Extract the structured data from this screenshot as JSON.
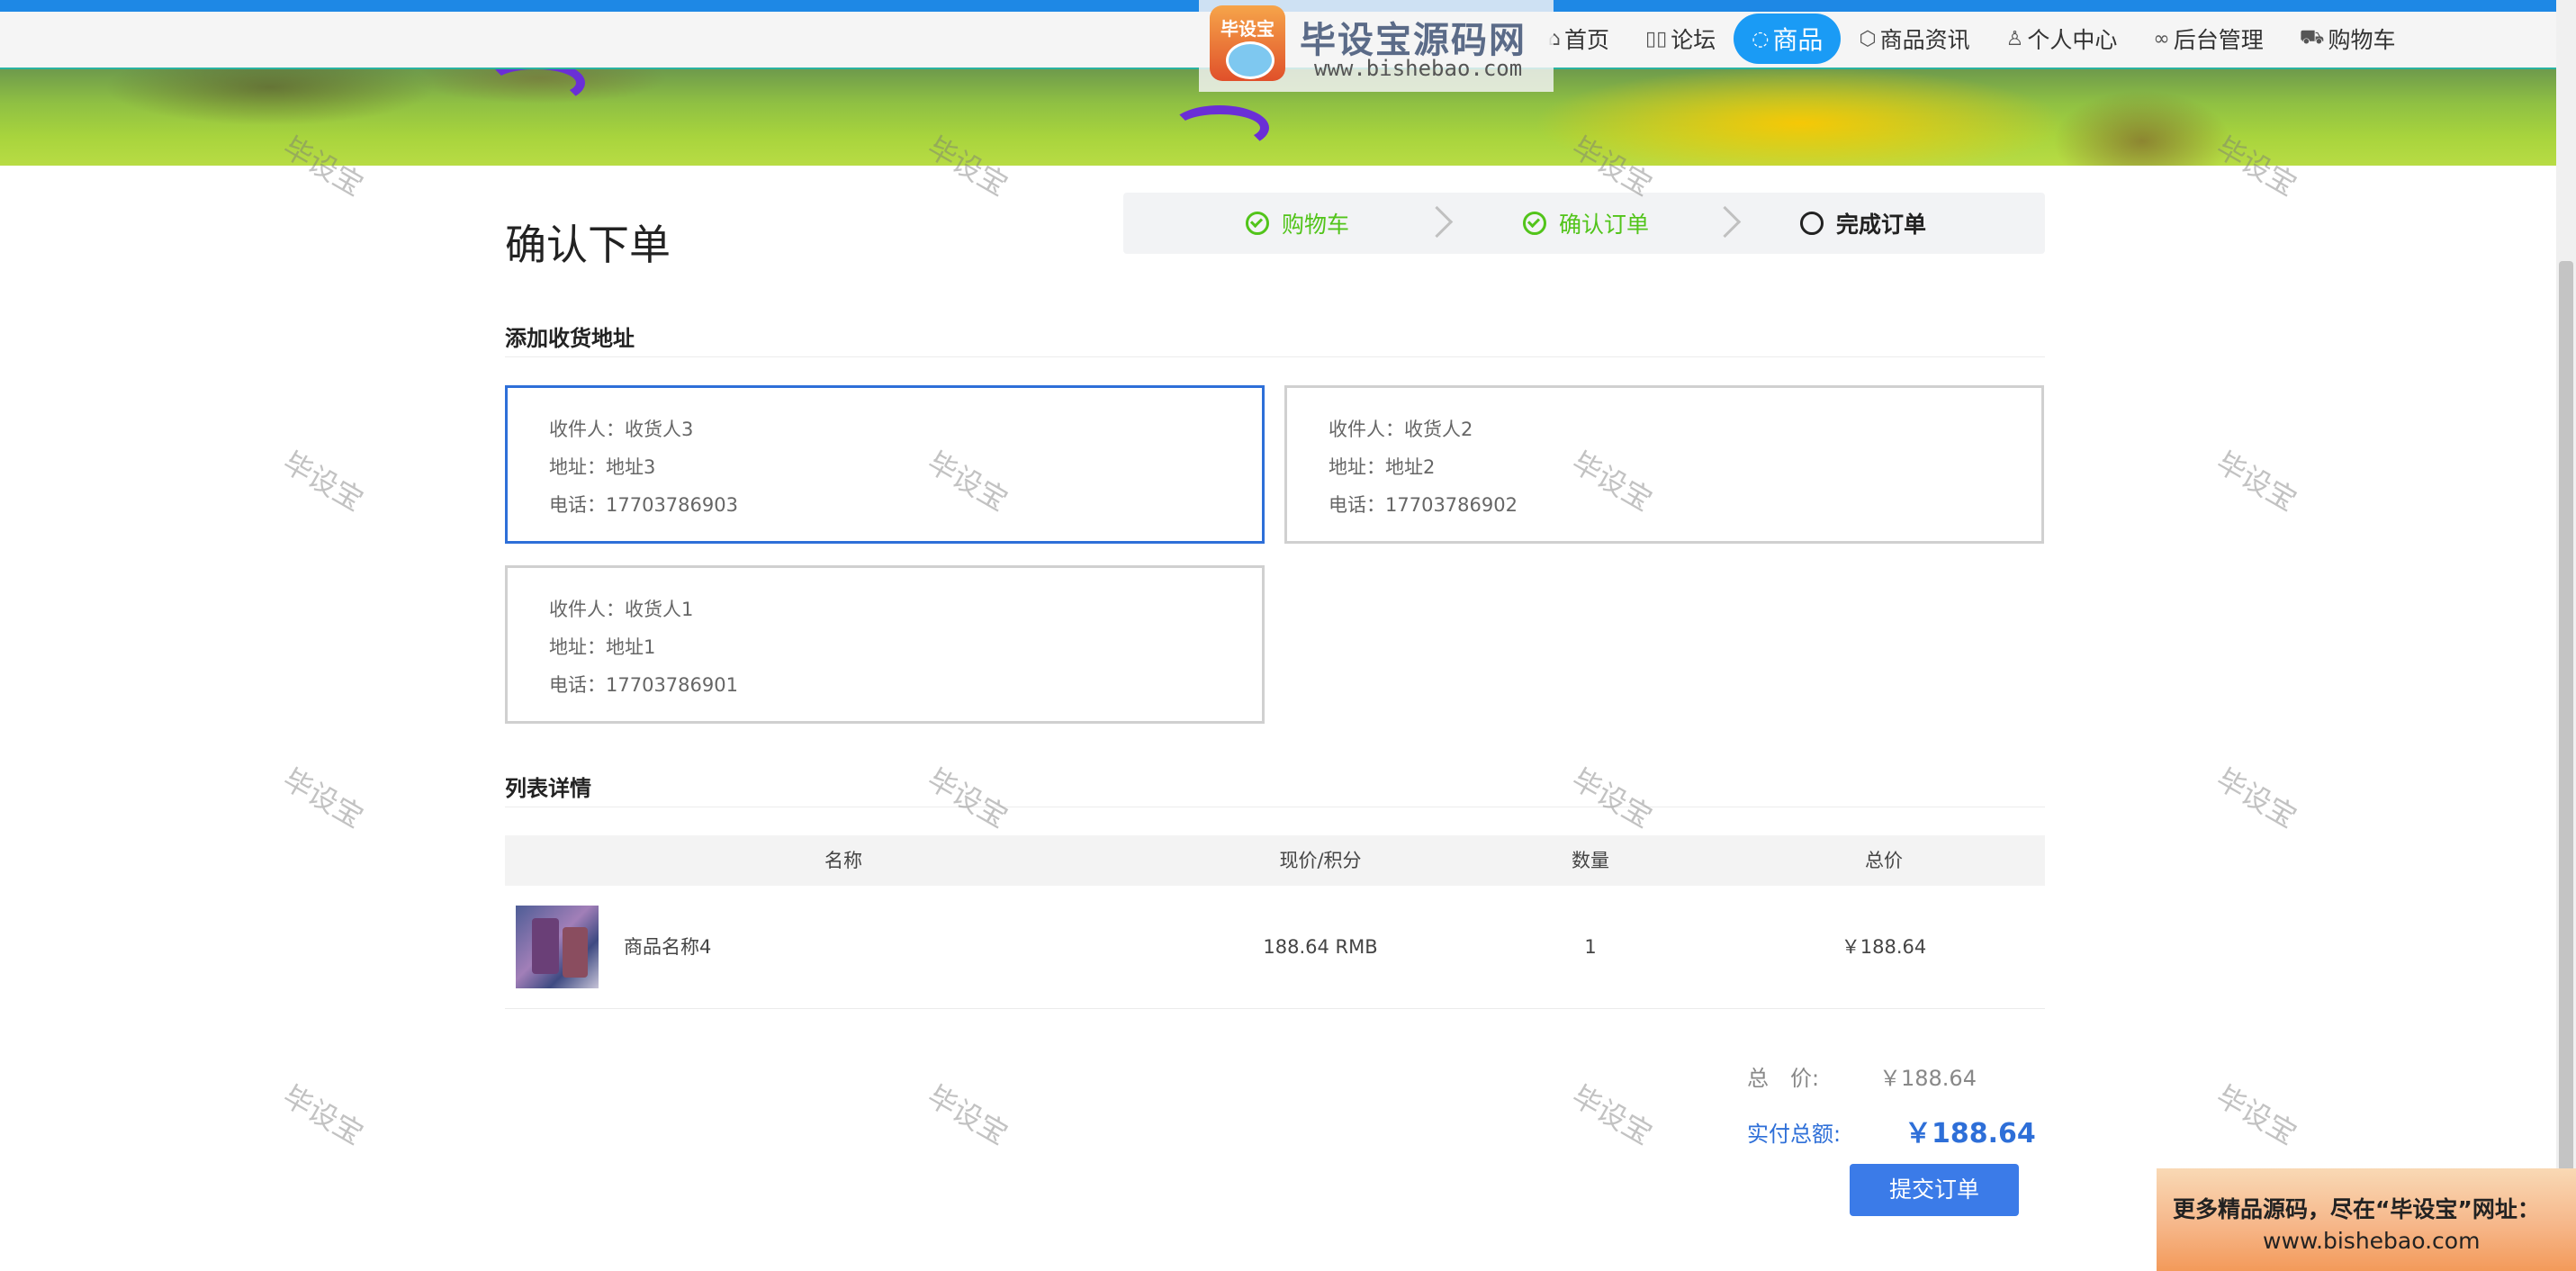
{
  "nav": {
    "items": [
      {
        "icon": "home-icon",
        "glyph": "⌂",
        "label": "首页"
      },
      {
        "icon": "forum-icon",
        "glyph": "▯▯",
        "label": "论坛"
      },
      {
        "icon": "chat-icon",
        "glyph": "◌",
        "label": "商品"
      },
      {
        "icon": "cube-icon",
        "glyph": "⬡",
        "label": "商品资讯"
      },
      {
        "icon": "user-icon",
        "glyph": "♙",
        "label": "个人中心"
      },
      {
        "icon": "link-icon",
        "glyph": "∞",
        "label": "后台管理"
      },
      {
        "icon": "cart-icon",
        "glyph": "⛟",
        "label": "购物车"
      }
    ],
    "active_index": 2,
    "active_color": "#1a9bf5"
  },
  "logo": {
    "badge_text": "毕设宝",
    "title": "毕设宝源码网",
    "url": "www.bishebao.com"
  },
  "page_title": "确认下单",
  "steps": [
    {
      "label": "购物车",
      "state": "done"
    },
    {
      "label": "确认订单",
      "state": "done"
    },
    {
      "label": "完成订单",
      "state": "current"
    }
  ],
  "address_section": {
    "title": "添加收货地址",
    "cards": [
      {
        "receiver": "收件人：收货人3",
        "address": "地址：地址3",
        "phone": "电话：17703786903",
        "selected": true
      },
      {
        "receiver": "收件人：收货人2",
        "address": "地址：地址2",
        "phone": "电话：17703786902",
        "selected": false
      },
      {
        "receiver": "收件人：收货人1",
        "address": "地址：地址1",
        "phone": "电话：17703786901",
        "selected": false
      }
    ]
  },
  "list_section": {
    "title": "列表详情",
    "headers": [
      "名称",
      "现价/积分",
      "数量",
      "总价"
    ],
    "rows": [
      {
        "name": "商品名称4",
        "price": "188.64 RMB",
        "qty": "1",
        "total": "￥188.64"
      }
    ]
  },
  "totals": {
    "total_label": "总　价:",
    "total_value": "￥188.64",
    "pay_label": "实付总额:",
    "pay_value": "￥188.64",
    "accent_color": "#2e6fd8"
  },
  "submit_label": "提交订单",
  "promo": {
    "line1": "更多精品源码，尽在“毕设宝”网址：",
    "line2": "www.bishebao.com"
  },
  "watermark_text": "毕设宝"
}
